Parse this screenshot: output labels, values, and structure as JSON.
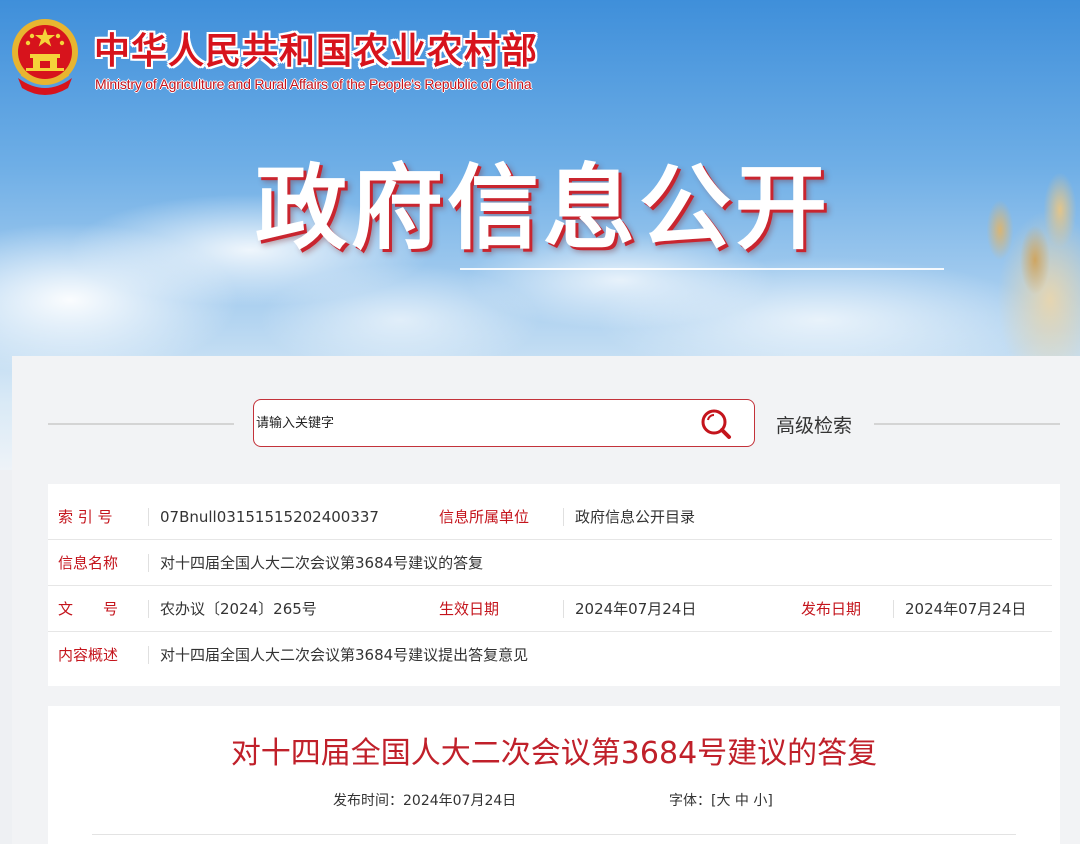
{
  "header": {
    "ministry_name_cn": "中华人民共和国农业农村部",
    "ministry_name_en": "Ministry of Agriculture and Rural Affairs of the People's Republic of China",
    "section_title": "政府信息公开"
  },
  "search": {
    "placeholder": "请输入关键字",
    "advanced_label": "高级检索"
  },
  "info": {
    "index_label": "索 引 号",
    "index_value": "07Bnull03151515202400337",
    "unit_label": "信息所属单位",
    "unit_value": "政府信息公开目录",
    "name_label": "信息名称",
    "name_value": "对十四届全国人大二次会议第3684号建议的答复",
    "doc_label": "文　　号",
    "doc_value": "农办议〔2024〕265号",
    "effective_label": "生效日期",
    "effective_value": "2024年07月24日",
    "publish_label": "发布日期",
    "publish_value": "2024年07月24日",
    "summary_label": "内容概述",
    "summary_value": "对十四届全国人大二次会议第3684号建议提出答复意见"
  },
  "article": {
    "title": "对十四届全国人大二次会议第3684号建议的答复",
    "publish_time_label": "发布时间：",
    "publish_time_value": "2024年07月24日",
    "font_label": "字体：",
    "font_open": "[",
    "font_large": "大",
    "font_medium": "中",
    "font_small": "小",
    "font_close": "]"
  },
  "colors": {
    "brand_red": "#c4141c",
    "title_red": "#c0202a",
    "sky_blue": "#3f8fda"
  },
  "icons": [
    "national-emblem-icon",
    "search-icon"
  ]
}
